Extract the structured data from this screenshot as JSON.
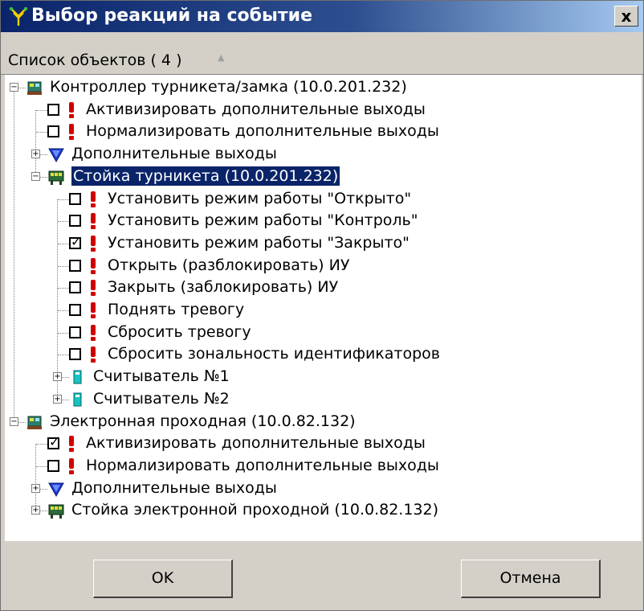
{
  "window": {
    "title": "Выбор реакций на событие",
    "close_label": "x"
  },
  "list_header": {
    "label": "Список объектов ( 4 )",
    "sort_indicator": "▲"
  },
  "tree": [
    {
      "label": "Контроллер турникета/замка (10.0.201.232)",
      "kind": "controller",
      "expander": "−",
      "checked": null,
      "selected": false
    },
    {
      "label": "Активизировать дополнительные выходы",
      "kind": "action",
      "checked": false
    },
    {
      "label": "Нормализировать дополнительные выходы",
      "kind": "action",
      "checked": false
    },
    {
      "label": "Дополнительные выходы",
      "kind": "outputs",
      "expander": "+"
    },
    {
      "label": "Стойка турникета (10.0.201.232)",
      "kind": "stand",
      "expander": "−",
      "selected": true
    },
    {
      "label": "Установить режим работы \"Открыто\"",
      "kind": "action",
      "checked": false
    },
    {
      "label": "Установить режим работы \"Контроль\"",
      "kind": "action",
      "checked": false
    },
    {
      "label": "Установить режим работы \"Закрыто\"",
      "kind": "action",
      "checked": true
    },
    {
      "label": "Открыть (разблокировать) ИУ",
      "kind": "action",
      "checked": false
    },
    {
      "label": "Закрыть (заблокировать) ИУ",
      "kind": "action",
      "checked": false
    },
    {
      "label": "Поднять тревогу",
      "kind": "action",
      "checked": false
    },
    {
      "label": "Сбросить тревогу",
      "kind": "action",
      "checked": false
    },
    {
      "label": "Сбросить зональность идентификаторов",
      "kind": "action",
      "checked": false
    },
    {
      "label": "Считыватель №1",
      "kind": "reader",
      "expander": "+"
    },
    {
      "label": "Считыватель №2",
      "kind": "reader",
      "expander": "+"
    },
    {
      "label": "Электронная проходная (10.0.82.132)",
      "kind": "controller",
      "expander": "−"
    },
    {
      "label": "Активизировать дополнительные выходы",
      "kind": "action",
      "checked": true
    },
    {
      "label": "Нормализировать дополнительные выходы",
      "kind": "action",
      "checked": false
    },
    {
      "label": "Дополнительные выходы",
      "kind": "outputs",
      "expander": "+"
    },
    {
      "label": "Стойка электронной проходной (10.0.82.132)",
      "kind": "stand",
      "expander": "+"
    }
  ],
  "buttons": {
    "ok_label": "OK",
    "cancel_label": "Отмена"
  },
  "icons": {
    "app": "tree-network-icon",
    "controller": "controller-icon",
    "action": "exclamation-icon",
    "outputs": "blue-triangle-icon",
    "stand": "turnstile-icon",
    "reader": "card-reader-icon"
  },
  "colors": {
    "title_start": "#0a246a",
    "title_end": "#a6caf0",
    "selection": "#0a246a",
    "action_icon": "#d00000",
    "outputs_icon": "#1a3ccc",
    "reader_icon": "#17c3c3"
  }
}
